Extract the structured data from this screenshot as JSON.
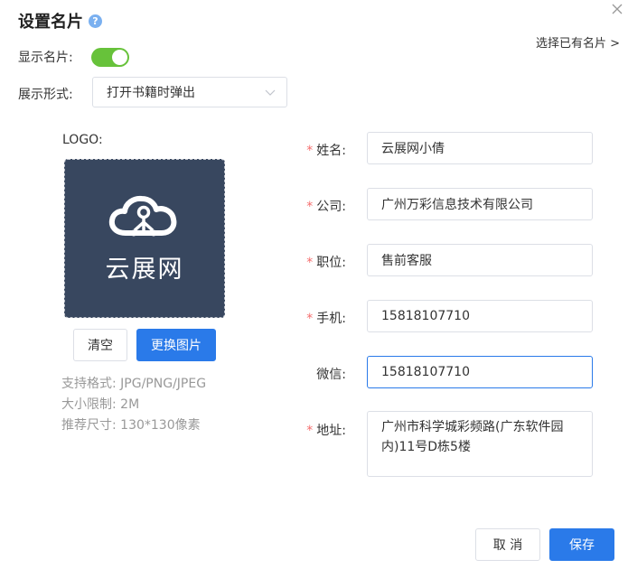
{
  "dialog": {
    "title": "设置名片",
    "help_icon": "question-circle-icon",
    "help_glyph": "?",
    "close_icon": "close-icon",
    "pick_existing_link": "选择已有名片 >"
  },
  "settings": {
    "show_card_label": "显示名片:",
    "show_card_enabled": true,
    "display_mode_label": "展示形式:",
    "display_mode_value": "打开书籍时弹出"
  },
  "logo": {
    "label": "LOGO:",
    "image_icon": "cloud-logo-icon",
    "image_text": "云展网",
    "clear_button": "清空",
    "replace_button": "更换图片",
    "hints": [
      "支持格式: JPG/PNG/JPEG",
      "大小限制: 2M",
      "推荐尺寸: 130*130像素"
    ]
  },
  "form": {
    "required_mark": "*",
    "name_label": "姓名:",
    "name_value": "云展网小倩",
    "company_label": "公司:",
    "company_value": "广州万彩信息技术有限公司",
    "position_label": "职位:",
    "position_value": "售前客服",
    "phone_label": "手机:",
    "phone_value": "15818107710",
    "wechat_label": "微信:",
    "wechat_value": "15818107710",
    "address_label": "地址:",
    "address_value": "广州市科学城彩频路(广东软件园内)11号D栋5楼"
  },
  "footer": {
    "cancel_button": "取 消",
    "save_button": "保存"
  },
  "colors": {
    "primary": "#2a7ae9",
    "toggle_on": "#67c23a",
    "logo_bg": "#38475f",
    "required": "#f56c6c"
  }
}
